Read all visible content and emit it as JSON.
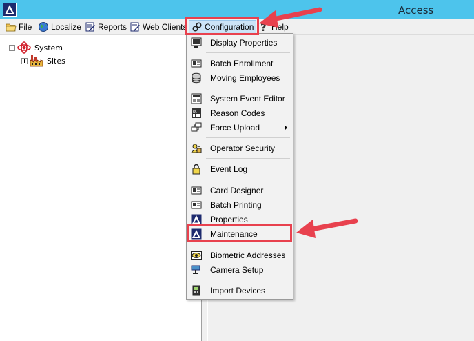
{
  "window": {
    "title": "Access"
  },
  "menubar": {
    "file": "File",
    "localize": "Localize",
    "reports": "Reports",
    "web_clients": "Web Clients",
    "configuration": "Configuration",
    "help": "Help"
  },
  "tree": {
    "root": "System",
    "child": "Sites"
  },
  "configuration_menu": {
    "display_properties": "Display Properties",
    "batch_enrollment": "Batch Enrollment",
    "moving_employees": "Moving Employees",
    "system_event_editor": "System Event Editor",
    "reason_codes": "Reason Codes",
    "force_upload": "Force Upload",
    "operator_security": "Operator Security",
    "event_log": "Event Log",
    "card_designer": "Card Designer",
    "batch_printing": "Batch Printing",
    "properties": "Properties",
    "maintenance": "Maintenance",
    "biometric_addresses": "Biometric Addresses",
    "camera_setup": "Camera Setup",
    "import_devices": "Import Devices"
  },
  "colors": {
    "titlebar": "#4dc4ec",
    "annotation": "#e8414e",
    "menu_highlight": "#cce4f7"
  }
}
